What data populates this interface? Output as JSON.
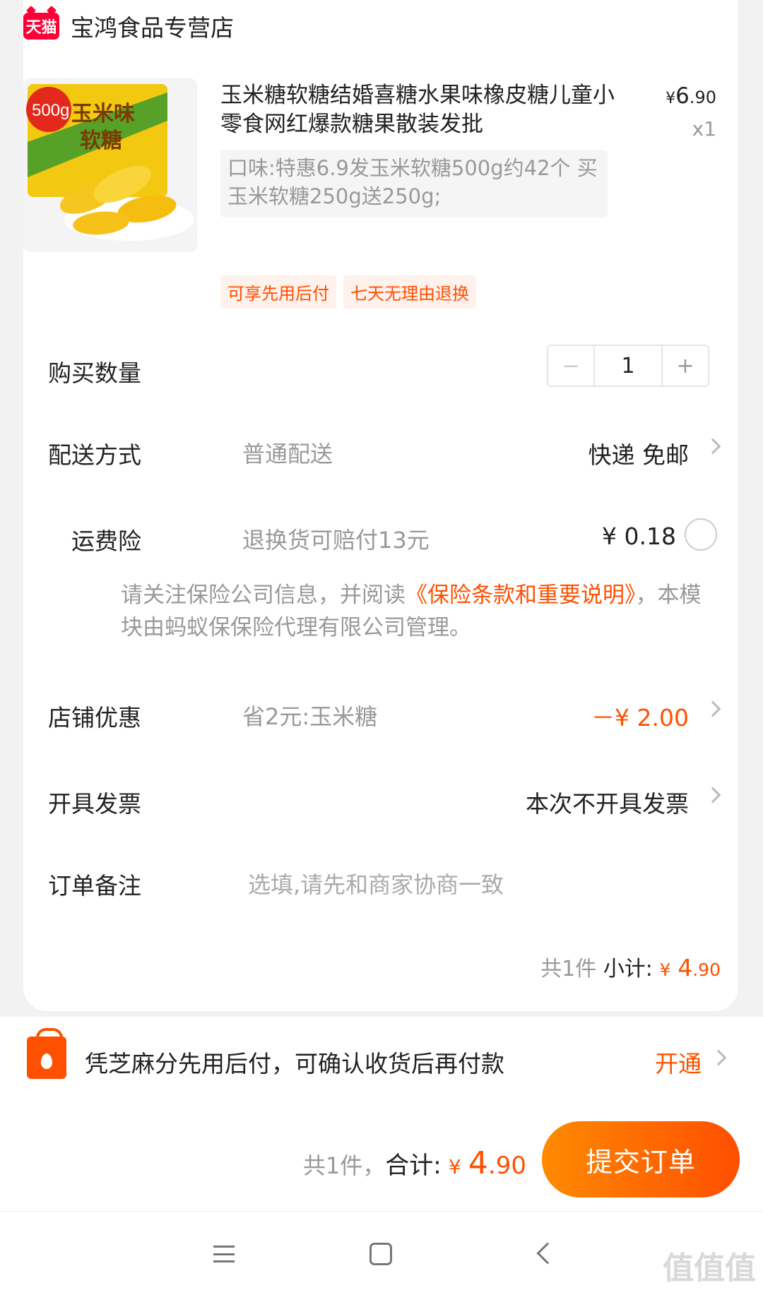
{
  "shop": {
    "badge": "天猫",
    "name": "宝鸿食品专营店"
  },
  "product": {
    "image_label": "500g 玉米味软糖",
    "title": "玉米糖软糖结婚喜糖水果味橡皮糖儿童小零食网红爆款糖果散装发批",
    "price_symbol": "¥",
    "price_int": "6",
    "price_dec": ".90",
    "qty": "x1",
    "spec": "口味:特惠6.9发玉米软糖500g约42个 买玉米软糖250g送250g;",
    "tags": [
      "可享先用后付",
      "七天无理由退换"
    ]
  },
  "rows": {
    "quantity": {
      "label": "购买数量",
      "value": "1",
      "minus": "−",
      "plus": "+"
    },
    "delivery": {
      "label": "配送方式",
      "sub": "普通配送",
      "value": "快递 免邮"
    },
    "insurance": {
      "label": "运费险",
      "sub": "退换货可赔付13元",
      "value": "¥ 0.18"
    },
    "insurance_note": {
      "prefix": "请关注保险公司信息，并阅读",
      "link": "《保险条款和重要说明》",
      "suffix": "，本模块由蚂蚁保保险代理有限公司管理。"
    },
    "discount": {
      "label": "店铺优惠",
      "sub": "省2元:玉米糖",
      "value": "－¥ 2.00"
    },
    "invoice": {
      "label": "开具发票",
      "value": "本次不开具发票"
    },
    "remark": {
      "label": "订单备注",
      "placeholder": "选填,请先和商家协商一致"
    }
  },
  "subtotal": {
    "count": "共1件",
    "label": "小计:",
    "symbol": "¥",
    "int": "4",
    "dec": ".90"
  },
  "zhima": {
    "text": "凭芝麻分先用后付，可确认收货后再付款",
    "action": "开通"
  },
  "footer": {
    "count": "共1件，",
    "label": "合计:",
    "symbol": "¥",
    "int": "4",
    "dec": ".90",
    "submit": "提交订单"
  },
  "watermark": "值值值",
  "colors": {
    "accent": "#ff5000",
    "tmall": "#ff0036"
  }
}
